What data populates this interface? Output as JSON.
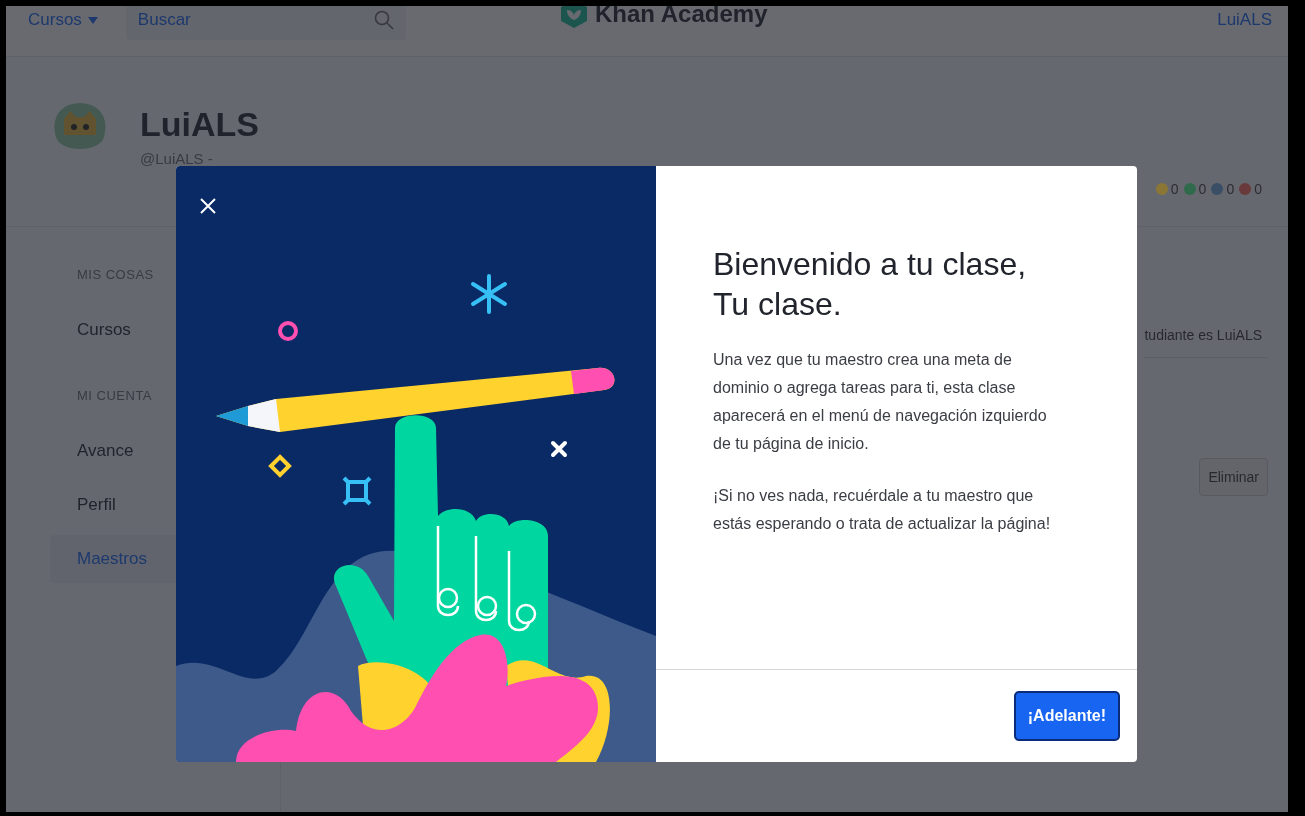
{
  "top_bar": {
    "courses_menu": "Cursos",
    "search": {
      "placeholder": "Buscar"
    },
    "logo": "Khan Academy",
    "user": "LuiALS"
  },
  "profile": {
    "name": "LuiALS",
    "handle": "@LuiALS -",
    "badges": [
      {
        "count": "0",
        "color": "#8c7636"
      },
      {
        "count": "0",
        "color": "#2f6a4c"
      },
      {
        "count": "0",
        "color": "#3a4f66"
      },
      {
        "count": "0",
        "color": "#6a3a3a"
      }
    ]
  },
  "sidebar": {
    "sections": [
      {
        "heading": "MIS COSAS",
        "items": [
          {
            "label": "Cursos",
            "selected": false
          }
        ]
      },
      {
        "heading": "MI CUENTA",
        "items": [
          {
            "label": "Avance",
            "selected": false
          },
          {
            "label": "Perfil",
            "selected": false
          },
          {
            "label": "Maestros",
            "selected": true
          }
        ]
      }
    ]
  },
  "main": {
    "student_text": "tudiante es LuiALS",
    "remove_button": "Eliminar"
  },
  "modal": {
    "title": "Bienvenido a tu clase, Tu clase.",
    "paragraphs": [
      "Una vez que tu maestro crea una meta de dominio o agrega tareas para ti, esta clase aparecerá en el menú de navegación izquierdo de tu página de inicio.",
      "¡Si no ves nada, recuérdale a tu maestro que estás esperando o trata de actualizar la página!"
    ],
    "button": "¡Adelante!"
  }
}
